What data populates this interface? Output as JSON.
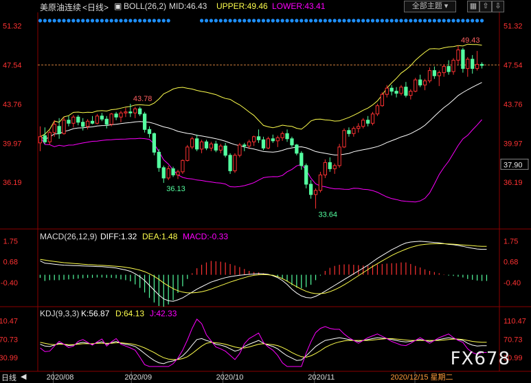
{
  "header": {
    "symbol": "美原油连续",
    "period": "<日线>",
    "boll_label": "BOLL(26,2)",
    "mid": "MID:46.43",
    "upper": "UPPER:49.46",
    "lower": "LOWER:43.41",
    "theme_button": "全部主题",
    "macd_label": "MACD(26,12,9)",
    "diff": "DIFF:1.32",
    "dea": "DEA:1.48",
    "macd_val": "MACD:-0.33",
    "kdj_label": "KDJ(9,3,3)",
    "k": "K:56.87",
    "d": "D:64.13",
    "j": "J:42.33",
    "period_tab": "日线",
    "watermark": "FX678"
  },
  "colors": {
    "up": "#ff3232",
    "down": "#54ffa0",
    "upper": "#ffff4d",
    "mid": "#ffffff",
    "lower": "#ff00ff",
    "diff": "#ffffff",
    "dea": "#ffff4d",
    "kj": "#ff00ff",
    "axis": "#ff3232",
    "date": "#dddddd",
    "grid": "#8b0000"
  },
  "chart_data": [
    {
      "type": "candlestick",
      "title": "美原油连续 <日线>",
      "y_ticks": [
        51.32,
        47.54,
        43.76,
        39.97,
        36.19
      ],
      "current_price": 37.9,
      "reference_price": 47.54,
      "annotations": [
        {
          "label": "43.78",
          "value": 43.78
        },
        {
          "label": "36.13",
          "value": 36.13
        },
        {
          "label": "33.64",
          "value": 33.64
        },
        {
          "label": "49.43",
          "value": 49.43
        }
      ],
      "x_labels": [
        "2020/08",
        "2020/09",
        "2020/10",
        "2020/11",
        "2020/12/15 星期二"
      ],
      "candles": [
        {
          "o": 40.0,
          "h": 41.6,
          "l": 39.2,
          "c": 40.6
        },
        {
          "o": 40.7,
          "h": 41.5,
          "l": 39.9,
          "c": 40.1
        },
        {
          "o": 40.1,
          "h": 41.2,
          "l": 39.8,
          "c": 41.0
        },
        {
          "o": 41.0,
          "h": 42.2,
          "l": 40.6,
          "c": 41.8
        },
        {
          "o": 41.6,
          "h": 42.4,
          "l": 40.4,
          "c": 40.9
        },
        {
          "o": 40.9,
          "h": 42.5,
          "l": 40.8,
          "c": 42.2
        },
        {
          "o": 42.2,
          "h": 42.6,
          "l": 41.6,
          "c": 41.9
        },
        {
          "o": 41.9,
          "h": 42.7,
          "l": 41.5,
          "c": 42.5
        },
        {
          "o": 42.5,
          "h": 42.7,
          "l": 41.7,
          "c": 42.0
        },
        {
          "o": 42.0,
          "h": 42.4,
          "l": 41.2,
          "c": 41.6
        },
        {
          "o": 41.6,
          "h": 42.3,
          "l": 41.3,
          "c": 42.1
        },
        {
          "o": 42.1,
          "h": 42.6,
          "l": 41.8,
          "c": 41.9
        },
        {
          "o": 41.9,
          "h": 42.8,
          "l": 41.8,
          "c": 42.6
        },
        {
          "o": 42.6,
          "h": 42.9,
          "l": 42.1,
          "c": 42.3
        },
        {
          "o": 42.3,
          "h": 42.6,
          "l": 41.4,
          "c": 41.8
        },
        {
          "o": 41.8,
          "h": 42.9,
          "l": 41.6,
          "c": 42.8
        },
        {
          "o": 42.8,
          "h": 43.0,
          "l": 42.2,
          "c": 42.5
        },
        {
          "o": 42.5,
          "h": 43.1,
          "l": 42.0,
          "c": 42.9
        },
        {
          "o": 42.9,
          "h": 43.4,
          "l": 42.5,
          "c": 43.0
        },
        {
          "o": 43.0,
          "h": 43.78,
          "l": 42.5,
          "c": 42.9
        },
        {
          "o": 42.9,
          "h": 43.5,
          "l": 42.4,
          "c": 43.3
        },
        {
          "o": 43.3,
          "h": 43.5,
          "l": 42.6,
          "c": 42.8
        },
        {
          "o": 42.8,
          "h": 43.0,
          "l": 41.0,
          "c": 41.3
        },
        {
          "o": 41.3,
          "h": 41.6,
          "l": 40.5,
          "c": 40.9
        },
        {
          "o": 40.9,
          "h": 41.0,
          "l": 38.8,
          "c": 39.1
        },
        {
          "o": 39.1,
          "h": 39.4,
          "l": 37.2,
          "c": 37.6
        },
        {
          "o": 37.6,
          "h": 37.8,
          "l": 36.13,
          "c": 36.6
        },
        {
          "o": 36.6,
          "h": 37.8,
          "l": 36.4,
          "c": 37.5
        },
        {
          "o": 37.5,
          "h": 37.7,
          "l": 36.7,
          "c": 36.9
        },
        {
          "o": 36.9,
          "h": 37.4,
          "l": 36.5,
          "c": 37.2
        },
        {
          "o": 37.2,
          "h": 38.4,
          "l": 37.0,
          "c": 38.3
        },
        {
          "o": 38.3,
          "h": 39.8,
          "l": 38.2,
          "c": 39.6
        },
        {
          "o": 39.6,
          "h": 40.6,
          "l": 39.4,
          "c": 40.4
        },
        {
          "o": 40.4,
          "h": 40.8,
          "l": 39.2,
          "c": 39.4
        },
        {
          "o": 39.4,
          "h": 40.3,
          "l": 39.0,
          "c": 40.1
        },
        {
          "o": 40.1,
          "h": 40.3,
          "l": 39.3,
          "c": 39.5
        },
        {
          "o": 39.5,
          "h": 40.1,
          "l": 39.2,
          "c": 39.9
        },
        {
          "o": 39.9,
          "h": 40.2,
          "l": 39.1,
          "c": 39.3
        },
        {
          "o": 39.3,
          "h": 39.9,
          "l": 39.0,
          "c": 39.7
        },
        {
          "o": 39.7,
          "h": 40.0,
          "l": 38.6,
          "c": 38.8
        },
        {
          "o": 38.8,
          "h": 39.0,
          "l": 37.0,
          "c": 37.3
        },
        {
          "o": 37.3,
          "h": 39.0,
          "l": 37.1,
          "c": 38.8
        },
        {
          "o": 38.8,
          "h": 40.0,
          "l": 38.6,
          "c": 39.8
        },
        {
          "o": 39.8,
          "h": 40.0,
          "l": 39.2,
          "c": 39.7
        },
        {
          "o": 39.7,
          "h": 40.3,
          "l": 39.4,
          "c": 40.1
        },
        {
          "o": 40.1,
          "h": 40.7,
          "l": 39.7,
          "c": 40.6
        },
        {
          "o": 40.6,
          "h": 41.3,
          "l": 40.0,
          "c": 40.3
        },
        {
          "o": 40.3,
          "h": 40.6,
          "l": 39.3,
          "c": 39.5
        },
        {
          "o": 39.5,
          "h": 40.6,
          "l": 39.4,
          "c": 40.4
        },
        {
          "o": 40.4,
          "h": 40.8,
          "l": 40.0,
          "c": 40.2
        },
        {
          "o": 40.2,
          "h": 40.7,
          "l": 39.6,
          "c": 40.5
        },
        {
          "o": 40.5,
          "h": 41.1,
          "l": 40.2,
          "c": 40.9
        },
        {
          "o": 40.9,
          "h": 41.3,
          "l": 40.1,
          "c": 40.4
        },
        {
          "o": 40.4,
          "h": 40.6,
          "l": 39.6,
          "c": 39.8
        },
        {
          "o": 39.8,
          "h": 39.9,
          "l": 38.8,
          "c": 39.0
        },
        {
          "o": 39.0,
          "h": 39.2,
          "l": 37.4,
          "c": 37.8
        },
        {
          "o": 37.8,
          "h": 38.0,
          "l": 35.6,
          "c": 36.0
        },
        {
          "o": 36.0,
          "h": 36.4,
          "l": 34.6,
          "c": 35.0
        },
        {
          "o": 35.0,
          "h": 35.6,
          "l": 33.64,
          "c": 35.4
        },
        {
          "o": 35.4,
          "h": 37.2,
          "l": 35.2,
          "c": 36.9
        },
        {
          "o": 36.9,
          "h": 38.4,
          "l": 36.6,
          "c": 38.1
        },
        {
          "o": 38.1,
          "h": 38.6,
          "l": 37.2,
          "c": 37.5
        },
        {
          "o": 37.5,
          "h": 38.0,
          "l": 37.0,
          "c": 37.8
        },
        {
          "o": 37.8,
          "h": 39.9,
          "l": 37.6,
          "c": 39.6
        },
        {
          "o": 39.6,
          "h": 41.4,
          "l": 39.5,
          "c": 41.2
        },
        {
          "o": 41.2,
          "h": 41.5,
          "l": 40.6,
          "c": 40.9
        },
        {
          "o": 40.9,
          "h": 41.6,
          "l": 40.6,
          "c": 41.4
        },
        {
          "o": 41.4,
          "h": 41.9,
          "l": 41.0,
          "c": 41.6
        },
        {
          "o": 41.6,
          "h": 42.4,
          "l": 41.4,
          "c": 42.2
        },
        {
          "o": 42.2,
          "h": 42.6,
          "l": 41.6,
          "c": 41.9
        },
        {
          "o": 41.9,
          "h": 43.0,
          "l": 41.7,
          "c": 42.8
        },
        {
          "o": 42.8,
          "h": 43.8,
          "l": 42.6,
          "c": 43.6
        },
        {
          "o": 43.6,
          "h": 44.9,
          "l": 43.5,
          "c": 44.7
        },
        {
          "o": 44.7,
          "h": 45.6,
          "l": 44.4,
          "c": 45.3
        },
        {
          "o": 45.3,
          "h": 45.6,
          "l": 44.6,
          "c": 45.0
        },
        {
          "o": 45.0,
          "h": 45.4,
          "l": 44.4,
          "c": 44.8
        },
        {
          "o": 44.8,
          "h": 45.6,
          "l": 44.6,
          "c": 45.4
        },
        {
          "o": 45.4,
          "h": 45.9,
          "l": 44.4,
          "c": 44.6
        },
        {
          "o": 44.6,
          "h": 45.2,
          "l": 44.2,
          "c": 45.0
        },
        {
          "o": 45.0,
          "h": 46.3,
          "l": 44.9,
          "c": 46.1
        },
        {
          "o": 46.1,
          "h": 46.6,
          "l": 45.4,
          "c": 45.6
        },
        {
          "o": 45.6,
          "h": 46.2,
          "l": 45.1,
          "c": 46.0
        },
        {
          "o": 46.0,
          "h": 47.3,
          "l": 45.8,
          "c": 47.0
        },
        {
          "o": 47.0,
          "h": 47.4,
          "l": 46.2,
          "c": 46.5
        },
        {
          "o": 46.5,
          "h": 47.0,
          "l": 45.5,
          "c": 46.8
        },
        {
          "o": 46.8,
          "h": 47.6,
          "l": 46.4,
          "c": 47.4
        },
        {
          "o": 47.4,
          "h": 48.0,
          "l": 46.6,
          "c": 46.9
        },
        {
          "o": 46.9,
          "h": 48.2,
          "l": 46.6,
          "c": 48.0
        },
        {
          "o": 48.0,
          "h": 49.43,
          "l": 47.6,
          "c": 49.0
        },
        {
          "o": 49.0,
          "h": 49.2,
          "l": 46.8,
          "c": 47.2
        },
        {
          "o": 47.2,
          "h": 48.3,
          "l": 46.4,
          "c": 48.1
        },
        {
          "o": 48.1,
          "h": 48.5,
          "l": 46.7,
          "c": 47.2
        },
        {
          "o": 47.2,
          "h": 48.9,
          "l": 47.0,
          "c": 47.6
        },
        {
          "o": 47.6,
          "h": 47.8,
          "l": 47.2,
          "c": 47.5
        }
      ]
    },
    {
      "type": "line",
      "title": "MACD(26,12,9)",
      "y_ticks": [
        1.75,
        0.68,
        -0.4
      ],
      "series": [
        {
          "name": "DIFF",
          "values": [
            0.72,
            0.6,
            0.58,
            0.55,
            0.52,
            0.5,
            0.49,
            0.48,
            0.47,
            0.46,
            0.45,
            0.44,
            0.43,
            0.42,
            0.4,
            0.38,
            0.35,
            0.3,
            0.25,
            0.18,
            0.05,
            -0.1,
            -0.3,
            -0.55,
            -0.8,
            -1.05,
            -1.25,
            -1.35,
            -1.38,
            -1.3,
            -1.2,
            -1.05,
            -0.9,
            -0.75,
            -0.62,
            -0.5,
            -0.38,
            -0.3,
            -0.22,
            -0.15,
            -0.1,
            -0.06,
            -0.02,
            0.0,
            0.02,
            0.04,
            0.06,
            0.05,
            0.02,
            -0.05,
            -0.15,
            -0.3,
            -0.5,
            -0.75,
            -0.95,
            -1.1,
            -1.18,
            -1.2,
            -1.12,
            -1.0,
            -0.85,
            -0.7,
            -0.55,
            -0.4,
            -0.25,
            -0.1,
            0.05,
            0.2,
            0.35,
            0.5,
            0.68,
            0.85,
            1.0,
            1.15,
            1.3,
            1.42,
            1.55,
            1.65,
            1.7,
            1.72,
            1.74,
            1.72,
            1.7,
            1.68,
            1.66,
            1.62,
            1.58,
            1.56,
            1.52,
            1.48,
            1.42,
            1.38,
            1.34,
            1.32,
            1.32
          ]
        },
        {
          "name": "DEA",
          "values": [
            0.8,
            0.76,
            0.72,
            0.69,
            0.66,
            0.63,
            0.61,
            0.59,
            0.57,
            0.55,
            0.53,
            0.52,
            0.5,
            0.49,
            0.48,
            0.46,
            0.44,
            0.42,
            0.39,
            0.35,
            0.3,
            0.24,
            0.16,
            0.05,
            -0.08,
            -0.24,
            -0.42,
            -0.58,
            -0.72,
            -0.83,
            -0.9,
            -0.94,
            -0.94,
            -0.92,
            -0.88,
            -0.82,
            -0.74,
            -0.65,
            -0.56,
            -0.47,
            -0.38,
            -0.3,
            -0.22,
            -0.15,
            -0.08,
            -0.03,
            0.0,
            0.01,
            0.0,
            -0.03,
            -0.1,
            -0.2,
            -0.33,
            -0.48,
            -0.62,
            -0.75,
            -0.86,
            -0.94,
            -0.98,
            -0.98,
            -0.95,
            -0.88,
            -0.78,
            -0.66,
            -0.52,
            -0.37,
            -0.21,
            -0.05,
            0.11,
            0.27,
            0.43,
            0.58,
            0.72,
            0.86,
            1.0,
            1.12,
            1.23,
            1.33,
            1.42,
            1.49,
            1.55,
            1.58,
            1.6,
            1.61,
            1.62,
            1.61,
            1.6,
            1.59,
            1.57,
            1.55,
            1.53,
            1.51,
            1.49,
            1.48,
            1.48
          ]
        }
      ]
    },
    {
      "type": "line",
      "title": "KDJ(9,3,3)",
      "y_ticks": [
        110.47,
        70.73,
        30.99
      ],
      "series": [
        {
          "name": "K",
          "values": [
            60,
            56,
            55,
            58,
            62,
            60,
            57,
            58,
            62,
            64,
            62,
            60,
            63,
            65,
            60,
            63,
            66,
            62,
            60,
            58,
            55,
            48,
            40,
            32,
            25,
            20,
            18,
            22,
            24,
            28,
            35,
            45,
            58,
            70,
            72,
            68,
            65,
            60,
            58,
            55,
            50,
            45,
            48,
            55,
            60,
            64,
            68,
            62,
            58,
            55,
            50,
            42,
            35,
            30,
            25,
            26,
            35,
            45,
            55,
            62,
            68,
            70,
            72,
            74,
            72,
            70,
            68,
            66,
            68,
            70,
            72,
            74,
            73,
            72,
            70,
            68,
            66,
            65,
            66,
            68,
            70,
            68,
            66,
            68,
            70,
            72,
            74,
            72,
            70,
            68,
            62,
            58,
            56,
            56.87,
            56.87
          ]
        },
        {
          "name": "D",
          "values": [
            64,
            62,
            60,
            59,
            60,
            60,
            59,
            59,
            60,
            61,
            61,
            61,
            62,
            62,
            62,
            62,
            63,
            63,
            62,
            61,
            59,
            56,
            52,
            47,
            42,
            36,
            31,
            28,
            27,
            27,
            29,
            33,
            40,
            48,
            56,
            62,
            64,
            63,
            62,
            60,
            57,
            54,
            52,
            52,
            54,
            57,
            60,
            61,
            60,
            59,
            57,
            53,
            48,
            42,
            37,
            33,
            32,
            35,
            40,
            46,
            53,
            58,
            62,
            65,
            67,
            68,
            68,
            68,
            68,
            68,
            69,
            70,
            71,
            72,
            72,
            71,
            70,
            69,
            68,
            68,
            68,
            68,
            68,
            68,
            68,
            69,
            70,
            71,
            71,
            70,
            68,
            66,
            65,
            64.13,
            64.13
          ]
        },
        {
          "name": "J",
          "values": [
            52,
            44,
            45,
            56,
            66,
            60,
            53,
            56,
            66,
            70,
            64,
            58,
            65,
            71,
            56,
            65,
            72,
            60,
            56,
            52,
            47,
            32,
            16,
            2,
            -9,
            -12,
            -8,
            10,
            18,
            30,
            47,
            69,
            94,
            114,
            104,
            80,
            67,
            54,
            50,
            45,
            36,
            27,
            40,
            61,
            72,
            78,
            84,
            64,
            54,
            47,
            36,
            20,
            9,
            6,
            1,
            12,
            41,
            65,
            85,
            94,
            98,
            94,
            92,
            92,
            82,
            74,
            68,
            62,
            68,
            74,
            78,
            82,
            77,
            72,
            66,
            62,
            58,
            57,
            62,
            68,
            74,
            68,
            62,
            68,
            74,
            78,
            82,
            74,
            68,
            64,
            50,
            42,
            38,
            42.33,
            42.33
          ]
        }
      ]
    }
  ]
}
